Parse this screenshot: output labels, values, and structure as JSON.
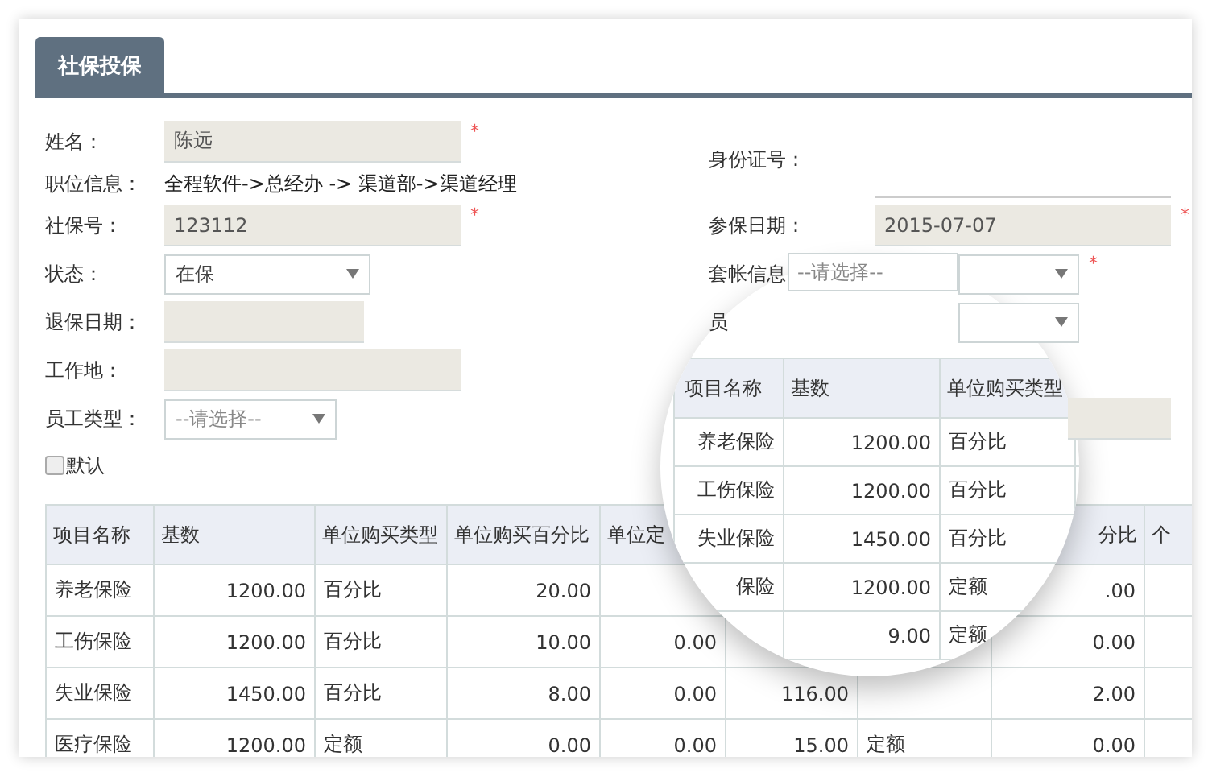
{
  "tab": {
    "label": "社保投保",
    "selected": true
  },
  "left_fields": [
    {
      "kind": "input",
      "label": "姓名：",
      "value": "陈远",
      "required_mark": "*"
    },
    {
      "kind": "text",
      "label": "职位信息：",
      "value": "全程软件->总经办 -> 渠道部->渠道经理"
    },
    {
      "kind": "input",
      "label": "社保号：",
      "value": "123112",
      "required_mark": "*"
    },
    {
      "kind": "select",
      "label": "状态：",
      "value": "在保"
    },
    {
      "kind": "input",
      "label": "退保日期："
    },
    {
      "kind": "input",
      "label": "工作地："
    },
    {
      "kind": "select",
      "label": "员工类型：",
      "placeholder": "--请选择--"
    }
  ],
  "checkbox": {
    "label": "默认",
    "checked": false
  },
  "right_fields": [
    {
      "kind": "line",
      "label": "身份证号："
    },
    {
      "kind": "input",
      "label": "参保日期：",
      "value": "2015-07-07",
      "required_mark": "*"
    },
    {
      "kind": "select",
      "label": "套帐信息",
      "required_mark": "*"
    },
    {
      "kind": "select",
      "label": "员"
    },
    {
      "kind": "input"
    }
  ],
  "table": {
    "columns": [
      {
        "label": "项目名称"
      },
      {
        "label": "基数"
      },
      {
        "label": "单位购买类型"
      },
      {
        "label": "单位购买百分比"
      },
      {
        "label": "单位定"
      },
      {},
      {},
      {
        "label": "分比"
      },
      {
        "label": "个"
      }
    ],
    "rows": [
      [
        "养老保险",
        "1200.00",
        "百分比",
        "20.00",
        null,
        null,
        null,
        ".00",
        null
      ],
      [
        "工伤保险",
        "1200.00",
        "百分比",
        "10.00",
        "0.00",
        null,
        null,
        "0.00",
        null
      ],
      [
        "失业保险",
        "1450.00",
        "百分比",
        "8.00",
        "0.00",
        "116.00",
        null,
        "2.00",
        null
      ],
      [
        "医疗保险",
        "1200.00",
        "定额",
        "0.00",
        "0.00",
        "15.00",
        "定额",
        "0.00",
        null
      ]
    ]
  },
  "magnifier": {
    "select": {
      "placeholder": "--请选择--"
    },
    "columns": [
      "项目名称",
      "基数",
      "单位购买类型"
    ],
    "rows": [
      [
        "养老保险",
        "1200.00",
        "百分比"
      ],
      [
        "工伤保险",
        "1200.00",
        "百分比"
      ],
      [
        "失业保险",
        "1450.00",
        "百分比"
      ],
      [
        "保险",
        "1200.00",
        "定额"
      ],
      [
        null,
        "9.00",
        "定额"
      ]
    ]
  }
}
